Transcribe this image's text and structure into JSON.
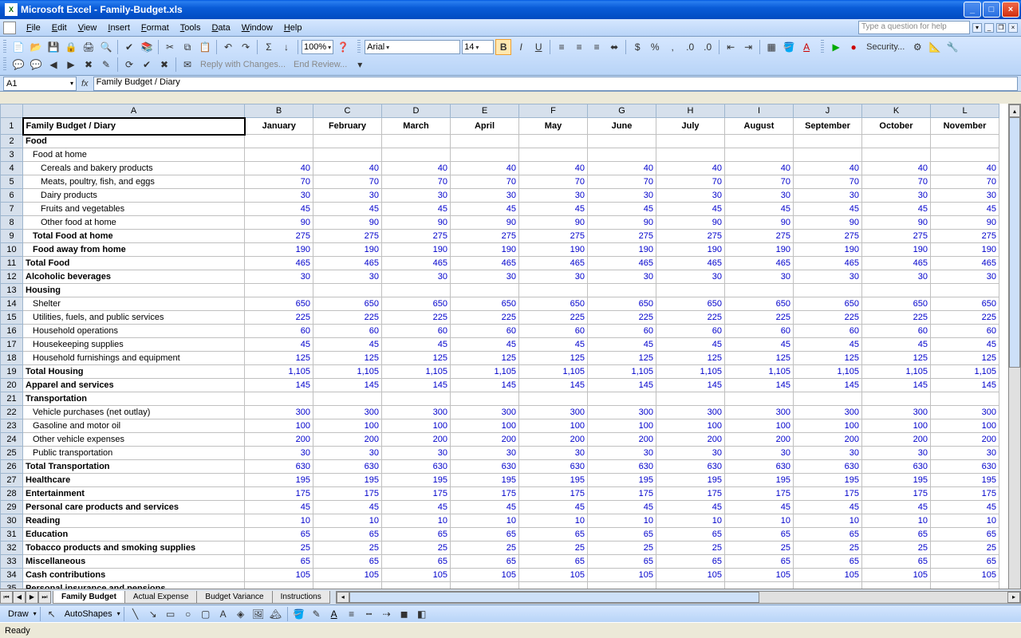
{
  "title": "Microsoft Excel - Family-Budget.xls",
  "menus": [
    "File",
    "Edit",
    "View",
    "Insert",
    "Format",
    "Tools",
    "Data",
    "Window",
    "Help"
  ],
  "help_placeholder": "Type a question for help",
  "zoom": "100%",
  "font_name": "Arial",
  "font_size": "14",
  "reply_label": "Reply with Changes...",
  "end_review_label": "End Review...",
  "security_label": "Security...",
  "name_box": "A1",
  "formula": "Family Budget / Diary",
  "columns": [
    "A",
    "B",
    "C",
    "D",
    "E",
    "F",
    "G",
    "H",
    "I",
    "J",
    "K",
    "L"
  ],
  "months": [
    "January",
    "February",
    "March",
    "April",
    "May",
    "June",
    "July",
    "August",
    "September",
    "October",
    "November"
  ],
  "main_title": "Family Budget / Diary",
  "rows": [
    {
      "n": 2,
      "label": "Food",
      "bold": true,
      "indent": 0,
      "vals": [
        "",
        "",
        "",
        "",
        "",
        "",
        "",
        "",
        "",
        "",
        ""
      ]
    },
    {
      "n": 3,
      "label": "Food at home",
      "bold": false,
      "indent": 1,
      "vals": [
        "",
        "",
        "",
        "",
        "",
        "",
        "",
        "",
        "",
        "",
        ""
      ]
    },
    {
      "n": 4,
      "label": "Cereals and bakery products",
      "bold": false,
      "indent": 2,
      "vals": [
        "40",
        "40",
        "40",
        "40",
        "40",
        "40",
        "40",
        "40",
        "40",
        "40",
        "40"
      ]
    },
    {
      "n": 5,
      "label": "Meats, poultry, fish, and eggs",
      "bold": false,
      "indent": 2,
      "vals": [
        "70",
        "70",
        "70",
        "70",
        "70",
        "70",
        "70",
        "70",
        "70",
        "70",
        "70"
      ]
    },
    {
      "n": 6,
      "label": "Dairy products",
      "bold": false,
      "indent": 2,
      "vals": [
        "30",
        "30",
        "30",
        "30",
        "30",
        "30",
        "30",
        "30",
        "30",
        "30",
        "30"
      ]
    },
    {
      "n": 7,
      "label": "Fruits and vegetables",
      "bold": false,
      "indent": 2,
      "vals": [
        "45",
        "45",
        "45",
        "45",
        "45",
        "45",
        "45",
        "45",
        "45",
        "45",
        "45"
      ]
    },
    {
      "n": 8,
      "label": "Other food at home",
      "bold": false,
      "indent": 2,
      "vals": [
        "90",
        "90",
        "90",
        "90",
        "90",
        "90",
        "90",
        "90",
        "90",
        "90",
        "90"
      ]
    },
    {
      "n": 9,
      "label": "Total Food at home",
      "bold": true,
      "indent": 1,
      "vals": [
        "275",
        "275",
        "275",
        "275",
        "275",
        "275",
        "275",
        "275",
        "275",
        "275",
        "275"
      ]
    },
    {
      "n": 10,
      "label": "Food away from home",
      "bold": true,
      "indent": 1,
      "vals": [
        "190",
        "190",
        "190",
        "190",
        "190",
        "190",
        "190",
        "190",
        "190",
        "190",
        "190"
      ]
    },
    {
      "n": 11,
      "label": "Total Food",
      "bold": true,
      "indent": 0,
      "vals": [
        "465",
        "465",
        "465",
        "465",
        "465",
        "465",
        "465",
        "465",
        "465",
        "465",
        "465"
      ]
    },
    {
      "n": 12,
      "label": "Alcoholic beverages",
      "bold": true,
      "indent": 0,
      "vals": [
        "30",
        "30",
        "30",
        "30",
        "30",
        "30",
        "30",
        "30",
        "30",
        "30",
        "30"
      ]
    },
    {
      "n": 13,
      "label": "Housing",
      "bold": true,
      "indent": 0,
      "vals": [
        "",
        "",
        "",
        "",
        "",
        "",
        "",
        "",
        "",
        "",
        ""
      ]
    },
    {
      "n": 14,
      "label": "Shelter",
      "bold": false,
      "indent": 1,
      "vals": [
        "650",
        "650",
        "650",
        "650",
        "650",
        "650",
        "650",
        "650",
        "650",
        "650",
        "650"
      ]
    },
    {
      "n": 15,
      "label": "Utilities, fuels, and public services",
      "bold": false,
      "indent": 1,
      "vals": [
        "225",
        "225",
        "225",
        "225",
        "225",
        "225",
        "225",
        "225",
        "225",
        "225",
        "225"
      ]
    },
    {
      "n": 16,
      "label": "Household operations",
      "bold": false,
      "indent": 1,
      "vals": [
        "60",
        "60",
        "60",
        "60",
        "60",
        "60",
        "60",
        "60",
        "60",
        "60",
        "60"
      ]
    },
    {
      "n": 17,
      "label": "Housekeeping supplies",
      "bold": false,
      "indent": 1,
      "vals": [
        "45",
        "45",
        "45",
        "45",
        "45",
        "45",
        "45",
        "45",
        "45",
        "45",
        "45"
      ]
    },
    {
      "n": 18,
      "label": "Household furnishings and equipment",
      "bold": false,
      "indent": 1,
      "vals": [
        "125",
        "125",
        "125",
        "125",
        "125",
        "125",
        "125",
        "125",
        "125",
        "125",
        "125"
      ]
    },
    {
      "n": 19,
      "label": "Total Housing",
      "bold": true,
      "indent": 0,
      "vals": [
        "1,105",
        "1,105",
        "1,105",
        "1,105",
        "1,105",
        "1,105",
        "1,105",
        "1,105",
        "1,105",
        "1,105",
        "1,105"
      ]
    },
    {
      "n": 20,
      "label": "Apparel and services",
      "bold": true,
      "indent": 0,
      "vals": [
        "145",
        "145",
        "145",
        "145",
        "145",
        "145",
        "145",
        "145",
        "145",
        "145",
        "145"
      ]
    },
    {
      "n": 21,
      "label": "Transportation",
      "bold": true,
      "indent": 0,
      "vals": [
        "",
        "",
        "",
        "",
        "",
        "",
        "",
        "",
        "",
        "",
        ""
      ]
    },
    {
      "n": 22,
      "label": "Vehicle purchases (net outlay)",
      "bold": false,
      "indent": 1,
      "vals": [
        "300",
        "300",
        "300",
        "300",
        "300",
        "300",
        "300",
        "300",
        "300",
        "300",
        "300"
      ]
    },
    {
      "n": 23,
      "label": "Gasoline and motor oil",
      "bold": false,
      "indent": 1,
      "vals": [
        "100",
        "100",
        "100",
        "100",
        "100",
        "100",
        "100",
        "100",
        "100",
        "100",
        "100"
      ]
    },
    {
      "n": 24,
      "label": "Other vehicle expenses",
      "bold": false,
      "indent": 1,
      "vals": [
        "200",
        "200",
        "200",
        "200",
        "200",
        "200",
        "200",
        "200",
        "200",
        "200",
        "200"
      ]
    },
    {
      "n": 25,
      "label": "Public transportation",
      "bold": false,
      "indent": 1,
      "vals": [
        "30",
        "30",
        "30",
        "30",
        "30",
        "30",
        "30",
        "30",
        "30",
        "30",
        "30"
      ]
    },
    {
      "n": 26,
      "label": "Total Transportation",
      "bold": true,
      "indent": 0,
      "vals": [
        "630",
        "630",
        "630",
        "630",
        "630",
        "630",
        "630",
        "630",
        "630",
        "630",
        "630"
      ]
    },
    {
      "n": 27,
      "label": "Healthcare",
      "bold": true,
      "indent": 0,
      "vals": [
        "195",
        "195",
        "195",
        "195",
        "195",
        "195",
        "195",
        "195",
        "195",
        "195",
        "195"
      ]
    },
    {
      "n": 28,
      "label": "Entertainment",
      "bold": true,
      "indent": 0,
      "vals": [
        "175",
        "175",
        "175",
        "175",
        "175",
        "175",
        "175",
        "175",
        "175",
        "175",
        "175"
      ]
    },
    {
      "n": 29,
      "label": "Personal care products and services",
      "bold": true,
      "indent": 0,
      "vals": [
        "45",
        "45",
        "45",
        "45",
        "45",
        "45",
        "45",
        "45",
        "45",
        "45",
        "45"
      ]
    },
    {
      "n": 30,
      "label": "Reading",
      "bold": true,
      "indent": 0,
      "vals": [
        "10",
        "10",
        "10",
        "10",
        "10",
        "10",
        "10",
        "10",
        "10",
        "10",
        "10"
      ]
    },
    {
      "n": 31,
      "label": "Education",
      "bold": true,
      "indent": 0,
      "vals": [
        "65",
        "65",
        "65",
        "65",
        "65",
        "65",
        "65",
        "65",
        "65",
        "65",
        "65"
      ]
    },
    {
      "n": 32,
      "label": "Tobacco products and smoking supplies",
      "bold": true,
      "indent": 0,
      "vals": [
        "25",
        "25",
        "25",
        "25",
        "25",
        "25",
        "25",
        "25",
        "25",
        "25",
        "25"
      ]
    },
    {
      "n": 33,
      "label": "Miscellaneous",
      "bold": true,
      "indent": 0,
      "vals": [
        "65",
        "65",
        "65",
        "65",
        "65",
        "65",
        "65",
        "65",
        "65",
        "65",
        "65"
      ]
    },
    {
      "n": 34,
      "label": "Cash contributions",
      "bold": true,
      "indent": 0,
      "vals": [
        "105",
        "105",
        "105",
        "105",
        "105",
        "105",
        "105",
        "105",
        "105",
        "105",
        "105"
      ]
    },
    {
      "n": 35,
      "label": "Personal insurance and pensions",
      "bold": true,
      "indent": 0,
      "vals": [
        "",
        "",
        "",
        "",
        "",
        "",
        "",
        "",
        "",
        "",
        ""
      ]
    }
  ],
  "sheet_tabs": [
    "Family Budget",
    "Actual Expense",
    "Budget Variance",
    "Instructions"
  ],
  "active_tab": 0,
  "draw_label": "Draw",
  "autoshapes_label": "AutoShapes",
  "status_text": "Ready"
}
